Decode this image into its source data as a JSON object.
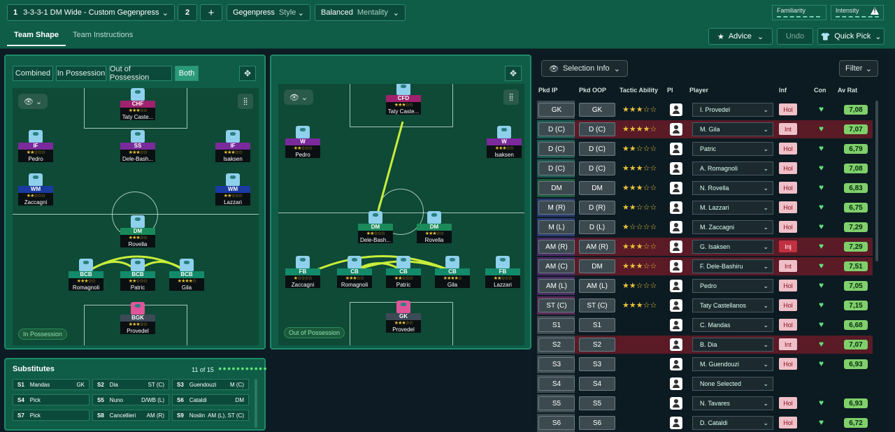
{
  "topbar": {
    "tactic_number": "1",
    "tactic_name": "3-3-3-1 DM Wide - Custom Gegenpress",
    "slot_number": "2",
    "add": "+",
    "style_value": "Gegenpress",
    "style_label": "Style",
    "mentality_value": "Balanced",
    "mentality_label": "Mentality",
    "familiarity_label": "Familiarity",
    "intensity_label": "Intensity",
    "intensity_warn": "!",
    "tabs": [
      "Team Shape",
      "Team Instructions"
    ],
    "advice_label": "Advice",
    "undo_label": "Undo",
    "quickpick_label": "Quick Pick"
  },
  "ip_panel": {
    "segments": [
      "Combined",
      "In Possession",
      "Out of Possession",
      "Both"
    ],
    "badge": "In Possession",
    "players": [
      {
        "pos": "CHF",
        "name": "Taty Caste...",
        "stars": "★★★☆☆",
        "color": "#a0226e"
      },
      {
        "pos": "IF",
        "name": "Pedro",
        "stars": "★★☆☆☆",
        "color": "#7a2a9a"
      },
      {
        "pos": "SS",
        "name": "Dele-Bash...",
        "stars": "★★★☆☆",
        "color": "#7a2a9a"
      },
      {
        "pos": "IF",
        "name": "Isaksen",
        "stars": "★★★☆☆",
        "color": "#7a2a9a"
      },
      {
        "pos": "WM",
        "name": "Zaccagni",
        "stars": "★★☆☆☆",
        "color": "#1a3aa0"
      },
      {
        "pos": "WM",
        "name": "Lazzari",
        "stars": "★★☆☆☆",
        "color": "#1a3aa0"
      },
      {
        "pos": "DM",
        "name": "Rovella",
        "stars": "★★★☆☆",
        "color": "#1a8a5a"
      },
      {
        "pos": "BCB",
        "name": "Romagnoli",
        "stars": "★★★☆☆",
        "color": "#138a6a"
      },
      {
        "pos": "BCB",
        "name": "Patric",
        "stars": "★★☆☆☆",
        "color": "#138a6a"
      },
      {
        "pos": "BCB",
        "name": "Gila",
        "stars": "★★★★☆",
        "color": "#138a6a"
      },
      {
        "pos": "BGK",
        "name": "Provedel",
        "stars": "★★★☆☆",
        "color": "#3c4a56"
      }
    ]
  },
  "oop_panel": {
    "badge": "Out of Possession",
    "players": [
      {
        "pos": "CFD",
        "name": "Taty Caste...",
        "stars": "★★★☆☆",
        "color": "#a0226e"
      },
      {
        "pos": "W",
        "name": "Pedro",
        "stars": "★★☆☆☆",
        "color": "#7a2a9a"
      },
      {
        "pos": "W",
        "name": "Isaksen",
        "stars": "★★★☆☆",
        "color": "#7a2a9a"
      },
      {
        "pos": "DM",
        "name": "Dele-Bash...",
        "stars": "★★☆☆☆",
        "color": "#1a8a5a"
      },
      {
        "pos": "DM",
        "name": "Rovella",
        "stars": "★★★☆☆",
        "color": "#1a8a5a"
      },
      {
        "pos": "FB",
        "name": "Zaccagni",
        "stars": "★☆☆☆☆",
        "color": "#138a6a"
      },
      {
        "pos": "CB",
        "name": "Romagnoli",
        "stars": "★★★☆☆",
        "color": "#138a6a"
      },
      {
        "pos": "CB",
        "name": "Patric",
        "stars": "★★☆☆☆",
        "color": "#138a6a"
      },
      {
        "pos": "CB",
        "name": "Gila",
        "stars": "★★★★☆",
        "color": "#138a6a"
      },
      {
        "pos": "FB",
        "name": "Lazzari",
        "stars": "★★☆☆☆",
        "color": "#138a6a"
      },
      {
        "pos": "GK",
        "name": "Provedel",
        "stars": "★★★☆☆",
        "color": "#3c4a56"
      }
    ]
  },
  "selection": {
    "dropdown": "Selection Info",
    "filter": "Filter",
    "headers": [
      "Pkd IP",
      "Pkd OOP",
      "Tactic Ability",
      "PI",
      "Player",
      "Inf",
      "Con",
      "Av Rat"
    ],
    "rows": [
      {
        "ip": "GK",
        "oop": "GK",
        "stars": "★★★☆☆",
        "player": "I. Provedel",
        "inf": "Hol",
        "rat": "7,08",
        "hl": "",
        "col": "#3c4a50"
      },
      {
        "ip": "D (C)",
        "oop": "D (C)",
        "stars": "★★★★☆",
        "player": "M. Gila",
        "inf": "Int",
        "rat": "7,07",
        "hl": "red",
        "col": "#1d5a52"
      },
      {
        "ip": "D (C)",
        "oop": "D (C)",
        "stars": "★★☆☆☆",
        "player": "Patric",
        "inf": "Hol",
        "rat": "6,79",
        "hl": "",
        "col": "#1d5a52"
      },
      {
        "ip": "D (C)",
        "oop": "D (C)",
        "stars": "★★★☆☆",
        "player": "A. Romagnoli",
        "inf": "Hol",
        "rat": "7,08",
        "hl": "",
        "col": "#1d5a52"
      },
      {
        "ip": "DM",
        "oop": "DM",
        "stars": "★★★☆☆",
        "player": "N. Rovella",
        "inf": "Hol",
        "rat": "6,83",
        "hl": "",
        "col": "#1a5a3a"
      },
      {
        "ip": "M (R)",
        "oop": "D (R)",
        "stars": "★★☆☆☆",
        "player": "M. Lazzari",
        "inf": "Hol",
        "rat": "6,75",
        "hl": "",
        "col": "#2a3a70"
      },
      {
        "ip": "M (L)",
        "oop": "D (L)",
        "stars": "★☆☆☆☆",
        "player": "M. Zaccagni",
        "inf": "Hol",
        "rat": "7,29",
        "hl": "",
        "col": "#2a3a70"
      },
      {
        "ip": "AM (R)",
        "oop": "AM (R)",
        "stars": "★★★☆☆",
        "player": "G. Isaksen",
        "inf": "Inj",
        "rat": "7,29",
        "hl": "red",
        "col": "#4a2a62"
      },
      {
        "ip": "AM (C)",
        "oop": "DM",
        "stars": "★★★☆☆",
        "player": "F. Dele-Bashiru",
        "inf": "Int",
        "rat": "7,51",
        "hl": "red",
        "col": "#4a2a62"
      },
      {
        "ip": "AM (L)",
        "oop": "AM (L)",
        "stars": "★★☆☆☆",
        "player": "Pedro",
        "inf": "Hol",
        "rat": "7,05",
        "hl": "",
        "col": "#4a2a62"
      },
      {
        "ip": "ST (C)",
        "oop": "ST (C)",
        "stars": "★★★☆☆",
        "player": "Taty Castellanos",
        "inf": "Hol",
        "rat": "7,15",
        "hl": "",
        "col": "#5a2a5a"
      },
      {
        "ip": "S1",
        "oop": "S1",
        "stars": "",
        "player": "C. Mandas",
        "inf": "Hol",
        "rat": "6,68",
        "hl": "",
        "col": "#3c4a50"
      },
      {
        "ip": "S2",
        "oop": "S2",
        "stars": "",
        "player": "B. Dia",
        "inf": "Int",
        "rat": "7,07",
        "hl": "red",
        "col": "#3c4a50"
      },
      {
        "ip": "S3",
        "oop": "S3",
        "stars": "",
        "player": "M. Guendouzi",
        "inf": "Hol",
        "rat": "6,93",
        "hl": "",
        "col": "#3c4a50"
      },
      {
        "ip": "S4",
        "oop": "S4",
        "stars": "",
        "player": "None Selected",
        "inf": "",
        "rat": "",
        "hl": "",
        "col": "#3c4a50"
      },
      {
        "ip": "S5",
        "oop": "S5",
        "stars": "",
        "player": "N. Tavares",
        "inf": "Hol",
        "rat": "6,93",
        "hl": "",
        "col": "#3c4a50"
      },
      {
        "ip": "S6",
        "oop": "S6",
        "stars": "",
        "player": "D. Cataldi",
        "inf": "Hol",
        "rat": "6,72",
        "hl": "",
        "col": "#3c4a50"
      }
    ]
  },
  "substitutes": {
    "title": "Substitutes",
    "count": "11 of 15",
    "cells": [
      {
        "slot": "S1",
        "name": "Mandas",
        "pos": "GK"
      },
      {
        "slot": "S2",
        "name": "Dia",
        "pos": "ST (C)"
      },
      {
        "slot": "S3",
        "name": "Guendouzi",
        "pos": "M (C)"
      },
      {
        "slot": "S4",
        "name": "Pick",
        "pos": ""
      },
      {
        "slot": "S5",
        "name": "Nuno",
        "pos": "D/WB (L)"
      },
      {
        "slot": "S6",
        "name": "Cataldi",
        "pos": "DM"
      },
      {
        "slot": "S7",
        "name": "Pick",
        "pos": ""
      },
      {
        "slot": "S8",
        "name": "Cancellieri",
        "pos": "AM (R)"
      },
      {
        "slot": "S9",
        "name": "Noslin",
        "pos": "AM (L), ST (C)"
      }
    ]
  }
}
